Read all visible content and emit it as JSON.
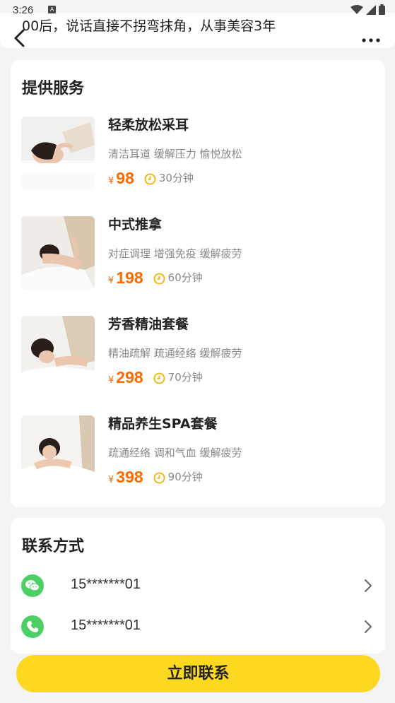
{
  "status_bar": {
    "time": "3:26",
    "a_icon": "A"
  },
  "header": {
    "text": "00后，说话直接不拐弯抹角，从事美容3年"
  },
  "services": {
    "title": "提供服务",
    "items": [
      {
        "name": "轻柔放松采耳",
        "desc": "清洁耳道 缓解压力 愉悦放松",
        "currency": "¥",
        "price": "98",
        "duration": "30分钟"
      },
      {
        "name": "中式推拿",
        "desc": "对症调理 增强免疫 缓解疲劳",
        "currency": "¥",
        "price": "198",
        "duration": "60分钟"
      },
      {
        "name": "芳香精油套餐",
        "desc": "精油疏解 疏通经络 缓解疲劳",
        "currency": "¥",
        "price": "298",
        "duration": "70分钟"
      },
      {
        "name": "精品养生SPA套餐",
        "desc": "疏通经络 调和气血 缓解疲劳",
        "currency": "¥",
        "price": "398",
        "duration": "90分钟"
      }
    ]
  },
  "contact": {
    "title": "联系方式",
    "items": [
      {
        "icon": "wechat-icon",
        "number": "15*******01"
      },
      {
        "icon": "phone-icon",
        "number": "15*******01"
      }
    ]
  },
  "cta": {
    "label": "立即联系"
  },
  "colors": {
    "accent": "#fdd820",
    "price": "#ff6a00",
    "contact_green": "#4cd065"
  }
}
